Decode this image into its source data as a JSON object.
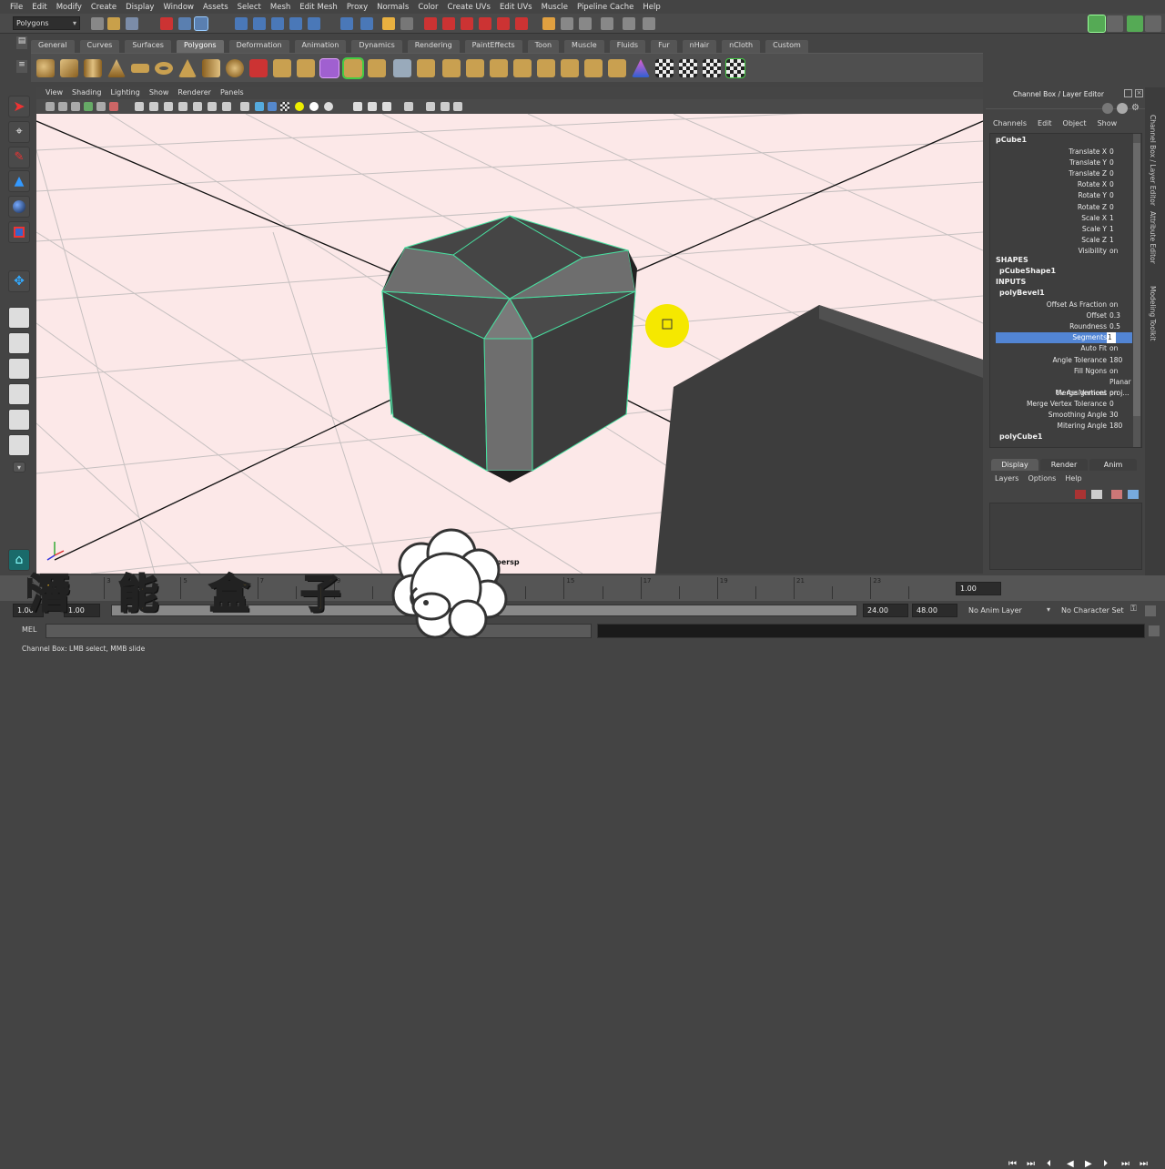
{
  "menubar": [
    "File",
    "Edit",
    "Modify",
    "Create",
    "Display",
    "Window",
    "Assets",
    "Select",
    "Mesh",
    "Edit Mesh",
    "Proxy",
    "Normals",
    "Color",
    "Create UVs",
    "Edit UVs",
    "Muscle",
    "Pipeline Cache",
    "Help"
  ],
  "status": {
    "mode": "Polygons"
  },
  "shelf_tabs": [
    "General",
    "Curves",
    "Surfaces",
    "Polygons",
    "Deformation",
    "Animation",
    "Dynamics",
    "Rendering",
    "PaintEffects",
    "Toon",
    "Muscle",
    "Fluids",
    "Fur",
    "nHair",
    "nCloth",
    "Custom"
  ],
  "shelf_active": "Polygons",
  "viewport": {
    "menu": [
      "View",
      "Shading",
      "Lighting",
      "Show",
      "Renderer",
      "Panels"
    ],
    "camera_label": "persp"
  },
  "channel_box": {
    "title": "Channel Box / Layer Editor",
    "menu": [
      "Channels",
      "Edit",
      "Object",
      "Show"
    ],
    "object": "pCube1",
    "attributes": [
      {
        "label": "Translate X",
        "value": "0"
      },
      {
        "label": "Translate Y",
        "value": "0"
      },
      {
        "label": "Translate Z",
        "value": "0"
      },
      {
        "label": "Rotate X",
        "value": "0"
      },
      {
        "label": "Rotate Y",
        "value": "0"
      },
      {
        "label": "Rotate Z",
        "value": "0"
      },
      {
        "label": "Scale X",
        "value": "1"
      },
      {
        "label": "Scale Y",
        "value": "1"
      },
      {
        "label": "Scale Z",
        "value": "1"
      },
      {
        "label": "Visibility",
        "value": "on"
      }
    ],
    "shapes_header": "SHAPES",
    "shape": "pCubeShape1",
    "inputs_header": "INPUTS",
    "input_node": "polyBevel1",
    "bevel_attrs": [
      {
        "label": "Offset As Fraction",
        "value": "on"
      },
      {
        "label": "Offset",
        "value": "0.3"
      },
      {
        "label": "Roundness",
        "value": "0.5"
      },
      {
        "label": "Segments",
        "value": "1",
        "selected": true
      },
      {
        "label": "Auto Fit",
        "value": "on"
      },
      {
        "label": "Angle Tolerance",
        "value": "180"
      },
      {
        "label": "Fill Ngons",
        "value": "on"
      },
      {
        "label": "Uv Assignment",
        "value": "Planar proj..."
      },
      {
        "label": "Merge Vertices",
        "value": "on"
      },
      {
        "label": "Merge Vertex Tolerance",
        "value": "0"
      },
      {
        "label": "Smoothing Angle",
        "value": "30"
      },
      {
        "label": "Mitering Angle",
        "value": "180"
      }
    ],
    "input_node2": "polyCube1"
  },
  "layer_editor": {
    "tabs": [
      "Display",
      "Render",
      "Anim"
    ],
    "active_tab": "Display",
    "menu": [
      "Layers",
      "Options",
      "Help"
    ]
  },
  "side_tabs": [
    "Channel Box / Layer Editor",
    "Attribute Editor",
    "Modeling Toolkit"
  ],
  "timeline": {
    "ticks": [
      "1",
      "2",
      "3",
      "4",
      "5",
      "6",
      "7",
      "8",
      "9",
      "10",
      "11",
      "12",
      "13",
      "14",
      "15",
      "16",
      "17",
      "18",
      "19",
      "20",
      "21",
      "22",
      "23",
      "24"
    ],
    "current_frame": "1.00"
  },
  "range": {
    "start": "1.00",
    "start_inner": "1.00",
    "end_inner_label": "24",
    "end": "24.00",
    "end_outer": "48.00",
    "anim_layer": "No Anim Layer",
    "char_set": "No Character Set"
  },
  "cmd": {
    "lang": "MEL"
  },
  "help": "Channel Box: LMB select, MMB slide",
  "watermark": {
    "chars": [
      "潛",
      "能",
      "盒",
      "子"
    ]
  },
  "colors": {
    "viewport_bg": "#fce8e8",
    "selection": "#5285d4",
    "wireframe_sel": "#48e0a0",
    "cursor_highlight": "#f5e800"
  }
}
